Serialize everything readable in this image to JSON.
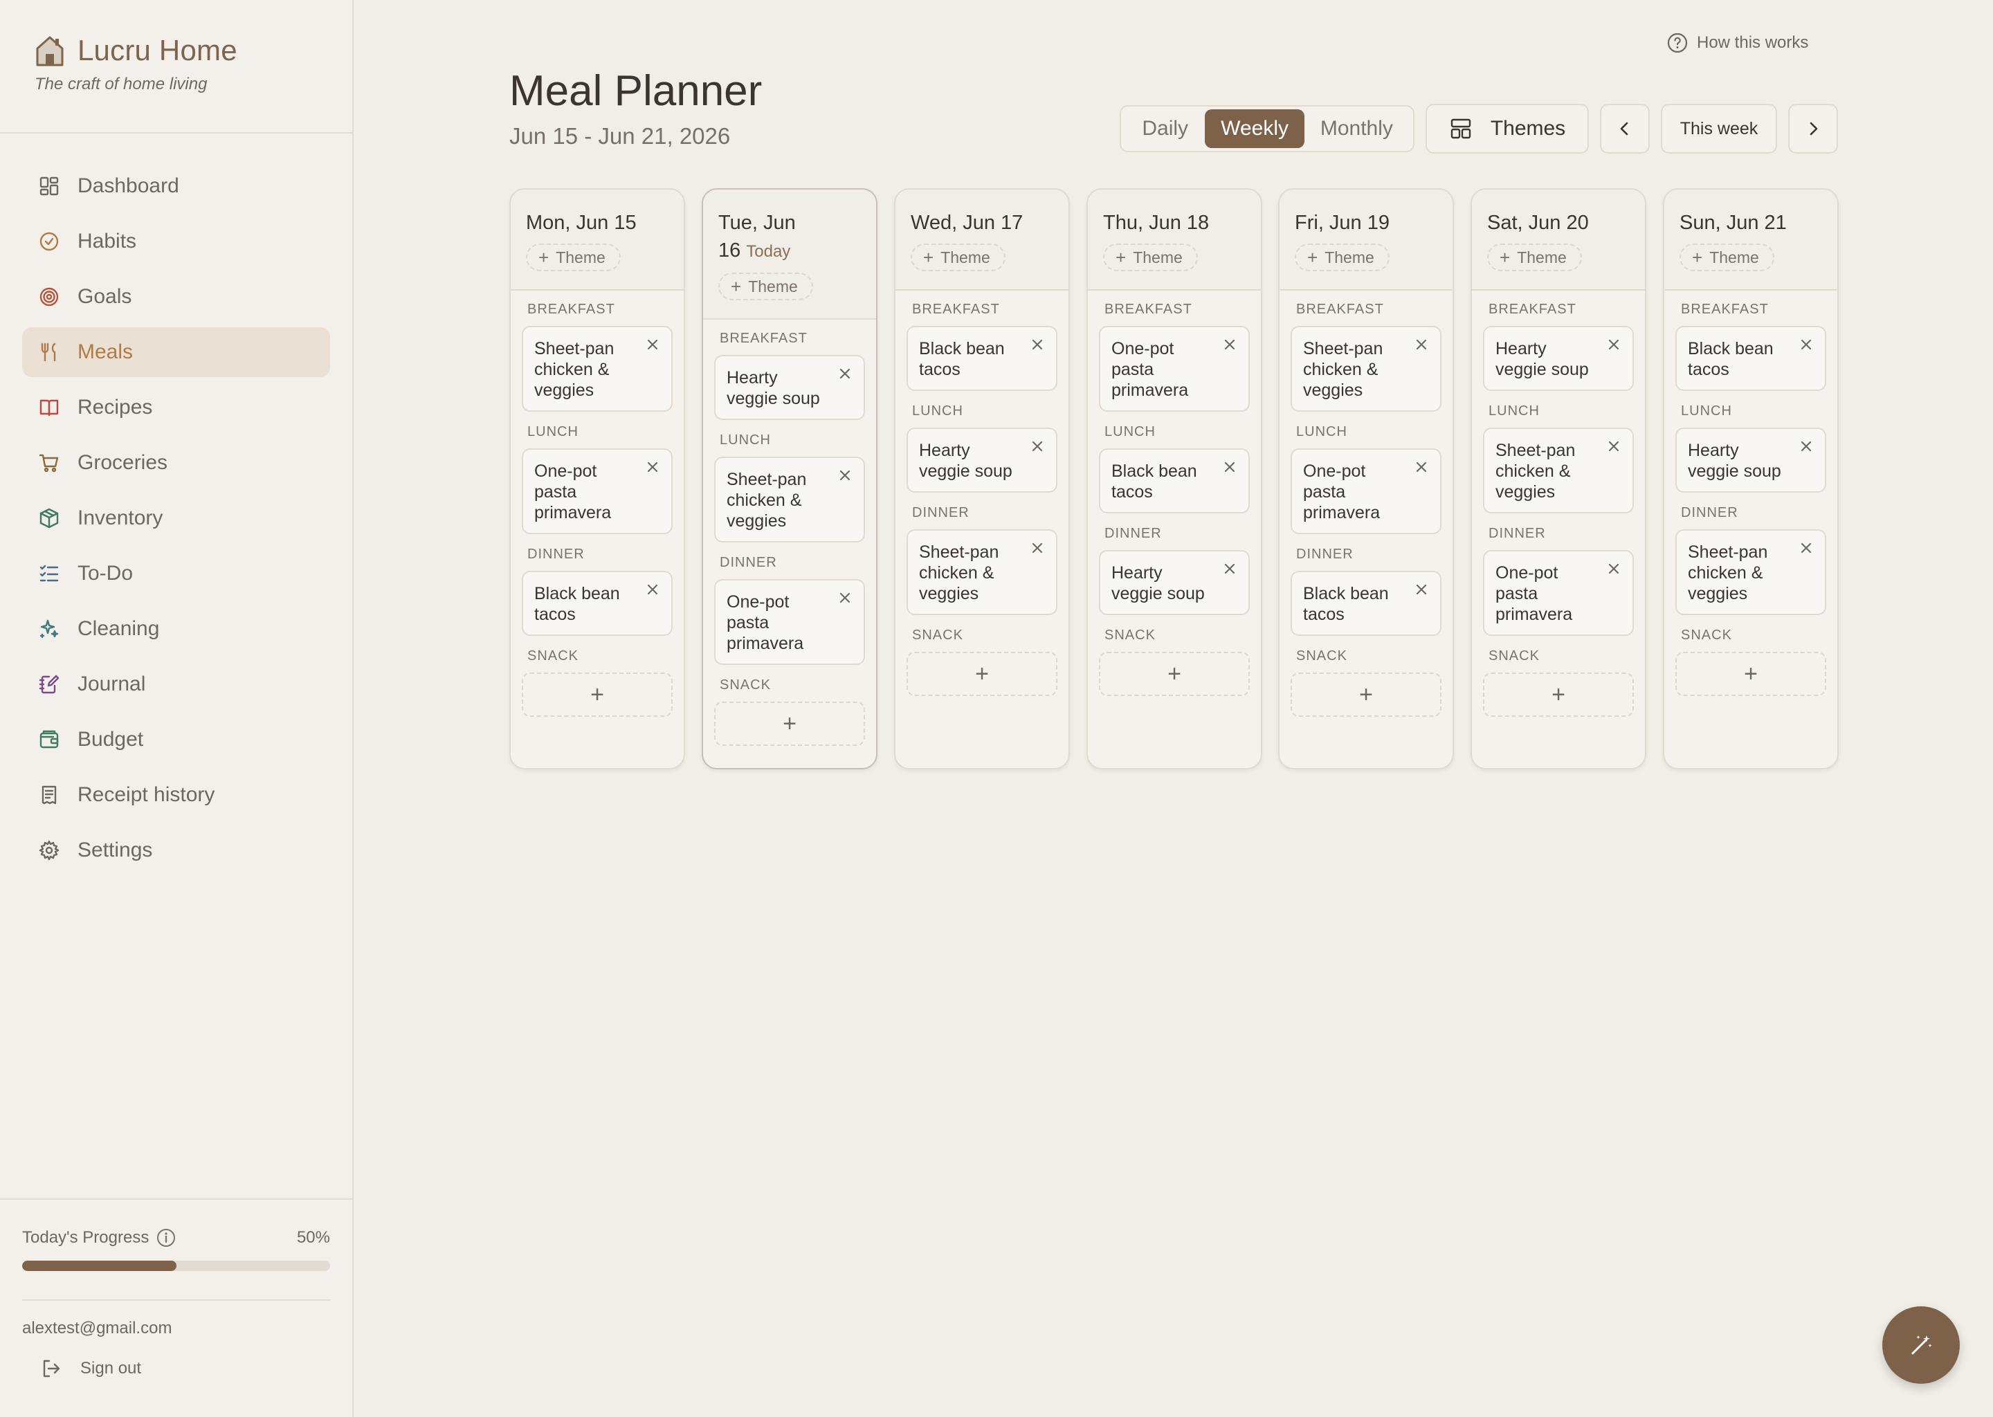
{
  "sidebar": {
    "brand_name": "Lucru Home",
    "tagline": "The craft of home living",
    "items": [
      {
        "label": "Dashboard",
        "icon": "dashboard-icon",
        "color": "#6e6760"
      },
      {
        "label": "Habits",
        "icon": "check-circle-icon",
        "color": "#b07b46"
      },
      {
        "label": "Goals",
        "icon": "target-icon",
        "color": "#b5533c"
      },
      {
        "label": "Meals",
        "icon": "utensils-icon",
        "color": "#b07b46"
      },
      {
        "label": "Recipes",
        "icon": "book-icon",
        "color": "#b94a3e"
      },
      {
        "label": "Groceries",
        "icon": "cart-icon",
        "color": "#8a6a3f"
      },
      {
        "label": "Inventory",
        "icon": "package-icon",
        "color": "#3e7a5e"
      },
      {
        "label": "To-Do",
        "icon": "list-icon",
        "color": "#4a6a8a"
      },
      {
        "label": "Cleaning",
        "icon": "sparkles-icon",
        "color": "#3e7a7a"
      },
      {
        "label": "Journal",
        "icon": "notebook-pen-icon",
        "color": "#7a4a8a"
      },
      {
        "label": "Budget",
        "icon": "wallet-icon",
        "color": "#3e7a5e"
      },
      {
        "label": "Receipt history",
        "icon": "receipt-icon",
        "color": "#6e6760"
      },
      {
        "label": "Settings",
        "icon": "gear-icon",
        "color": "#6e6760"
      }
    ],
    "active": "Meals",
    "progress": {
      "label": "Today's Progress",
      "value_text": "50%",
      "value": 0.5
    },
    "email": "alextest@gmail.com",
    "signout_label": "Sign out"
  },
  "header": {
    "help_label": "How this works",
    "title": "Meal Planner",
    "range": "Jun 15 - Jun 21, 2026",
    "views": [
      "Daily",
      "Weekly",
      "Monthly"
    ],
    "active_view": "Weekly",
    "themes_label": "Themes",
    "this_week_label": "This week"
  },
  "slot_labels": {
    "breakfast": "BREAKFAST",
    "lunch": "LUNCH",
    "dinner": "DINNER",
    "snack": "SNACK"
  },
  "theme_label": "Theme",
  "today_label": "Today",
  "days": [
    {
      "title": "Mon, Jun 15",
      "today": false,
      "breakfast": "Sheet-pan chicken & veggies",
      "lunch": "One-pot pasta primavera",
      "dinner": "Black bean tacos"
    },
    {
      "title": "Tue, Jun 16",
      "today": true,
      "breakfast": "Hearty veggie soup",
      "lunch": "Sheet-pan chicken & veggies",
      "dinner": "One-pot pasta primavera"
    },
    {
      "title": "Wed, Jun 17",
      "today": false,
      "breakfast": "Black bean tacos",
      "lunch": "Hearty veggie soup",
      "dinner": "Sheet-pan chicken & veggies"
    },
    {
      "title": "Thu, Jun 18",
      "today": false,
      "breakfast": "One-pot pasta primavera",
      "lunch": "Black bean tacos",
      "dinner": "Hearty veggie soup"
    },
    {
      "title": "Fri, Jun 19",
      "today": false,
      "breakfast": "Sheet-pan chicken & veggies",
      "lunch": "One-pot pasta primavera",
      "dinner": "Black bean tacos"
    },
    {
      "title": "Sat, Jun 20",
      "today": false,
      "breakfast": "Hearty veggie soup",
      "lunch": "Sheet-pan chicken & veggies",
      "dinner": "One-pot pasta primavera"
    },
    {
      "title": "Sun, Jun 21",
      "today": false,
      "breakfast": "Black bean tacos",
      "lunch": "Hearty veggie soup",
      "dinner": "Sheet-pan chicken & veggies"
    }
  ],
  "colors": {
    "accent": "#7d6249",
    "active_nav_bg": "#eae0d4",
    "active_nav_text": "#b07b46",
    "background": "#f1ede7"
  }
}
